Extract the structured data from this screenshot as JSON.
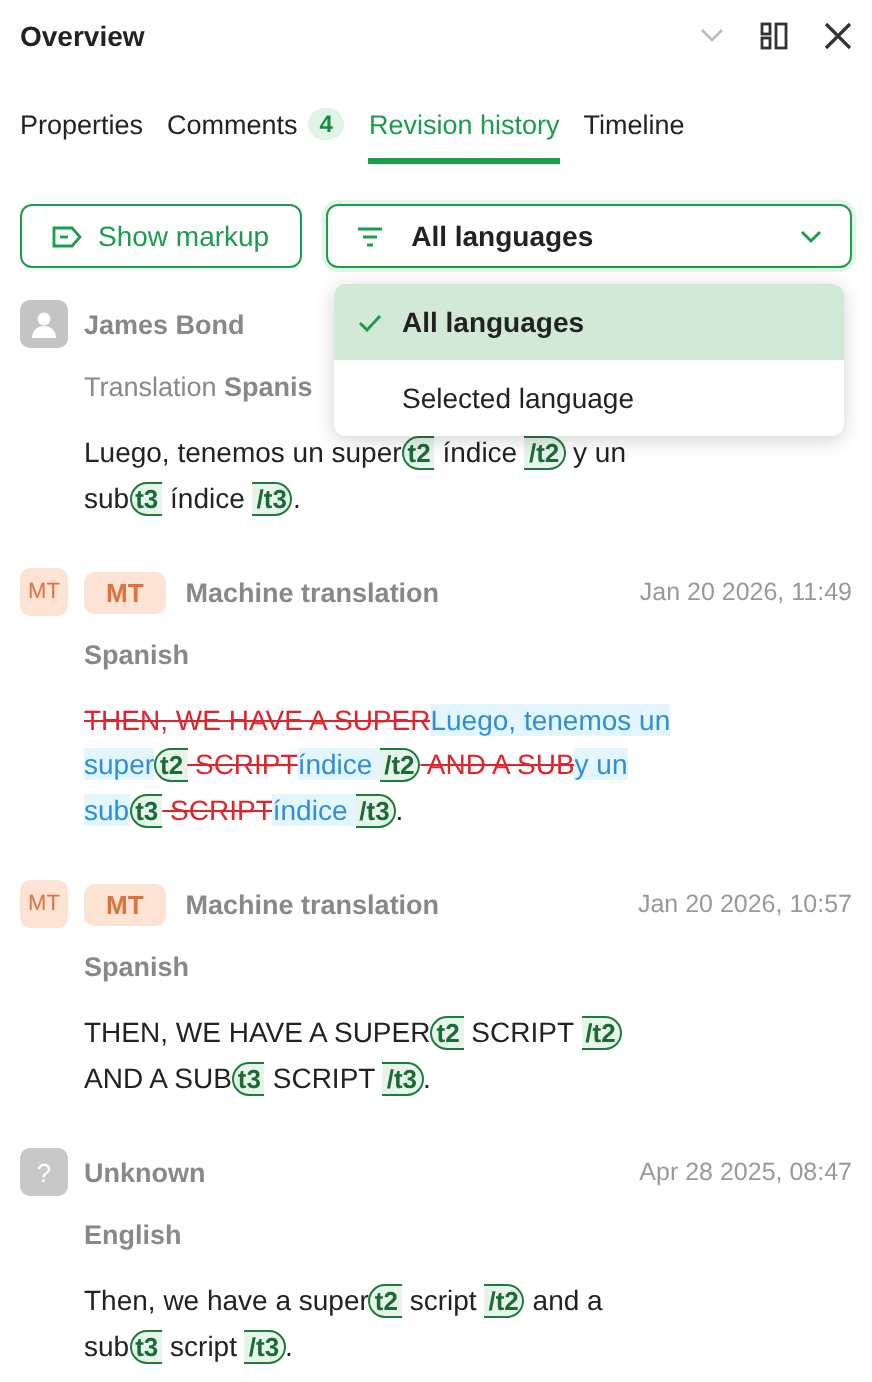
{
  "header": {
    "title": "Overview"
  },
  "tabs": [
    {
      "label": "Properties",
      "selected": false
    },
    {
      "label": "Comments",
      "count": "4",
      "selected": false
    },
    {
      "label": "Revision history",
      "selected": true
    },
    {
      "label": "Timeline",
      "selected": false
    }
  ],
  "toolbar": {
    "markup_button": "Show markup",
    "filter": {
      "value": "All languages",
      "expanded": true
    }
  },
  "filter_menu": [
    {
      "label": "All languages",
      "selected": true
    },
    {
      "label": "Selected language",
      "selected": false
    }
  ],
  "revisions": [
    {
      "avatar": {
        "kind": "user"
      },
      "author": "James Bond",
      "subtitle": "Translation **Spanis**",
      "body": [
        {
          "kind": "text",
          "text": "Luego, tenemos un super"
        },
        {
          "kind": "open_tag",
          "text": "t2"
        },
        {
          "kind": "text",
          "text": " índice "
        },
        {
          "kind": "close_tag",
          "text": "/t2"
        },
        {
          "kind": "text",
          "text": " y un sub"
        },
        {
          "kind": "open_tag",
          "text": "t3"
        },
        {
          "kind": "text",
          "text": " índice "
        },
        {
          "kind": "close_tag",
          "text": "/t3"
        },
        {
          "kind": "text",
          "text": "."
        }
      ]
    },
    {
      "avatar": {
        "kind": "initials",
        "text": "MT"
      },
      "badge": "MT",
      "author": "Machine translation",
      "date": "Jan 20 2026, 11:49",
      "subtitle": "Spanish",
      "body": [
        {
          "kind": "deleted",
          "text": "THEN, WE HAVE A SUPER"
        },
        {
          "kind": "inserted",
          "text": "Luego, tenemos un super"
        },
        {
          "kind": "open_tag",
          "text": "t2"
        },
        {
          "kind": "deleted",
          "text": " SCRIPT"
        },
        {
          "kind": "inserted",
          "text": "índice "
        },
        {
          "kind": "close_tag",
          "text": "/t2"
        },
        {
          "kind": "deleted",
          "text": " AND A SUB"
        },
        {
          "kind": "inserted",
          "text": "y un sub"
        },
        {
          "kind": "open_tag",
          "text": "t3"
        },
        {
          "kind": "deleted",
          "text": " SCRIPT"
        },
        {
          "kind": "inserted",
          "text": "índice "
        },
        {
          "kind": "close_tag",
          "text": "/t3"
        },
        {
          "kind": "text",
          "text": "."
        }
      ]
    },
    {
      "avatar": {
        "kind": "initials",
        "text": "MT"
      },
      "badge": "MT",
      "author": "Machine translation",
      "date": "Jan 20 2026, 10:57",
      "subtitle": "Spanish",
      "body": [
        {
          "kind": "text",
          "text": "THEN, WE HAVE A SUPER"
        },
        {
          "kind": "open_tag",
          "text": "t2"
        },
        {
          "kind": "text",
          "text": " SCRIPT "
        },
        {
          "kind": "close_tag",
          "text": "/t2"
        },
        {
          "kind": "text",
          "text": " AND A SUB"
        },
        {
          "kind": "open_tag",
          "text": "t3"
        },
        {
          "kind": "text",
          "text": " SCRIPT "
        },
        {
          "kind": "close_tag",
          "text": "/t3"
        },
        {
          "kind": "text",
          "text": "."
        }
      ]
    },
    {
      "avatar": {
        "kind": "unknown",
        "text": "?"
      },
      "author": "Unknown",
      "date": "Apr 28 2025, 08:47",
      "subtitle": "English",
      "body": [
        {
          "kind": "text",
          "text": "Then, we have a super"
        },
        {
          "kind": "open_tag",
          "text": "t2"
        },
        {
          "kind": "text",
          "text": " script "
        },
        {
          "kind": "close_tag",
          "text": "/t2"
        },
        {
          "kind": "text",
          "text": " and a sub"
        },
        {
          "kind": "open_tag",
          "text": "t3"
        },
        {
          "kind": "text",
          "text": " script "
        },
        {
          "kind": "close_tag",
          "text": "/t3"
        },
        {
          "kind": "text",
          "text": "."
        }
      ]
    }
  ]
}
